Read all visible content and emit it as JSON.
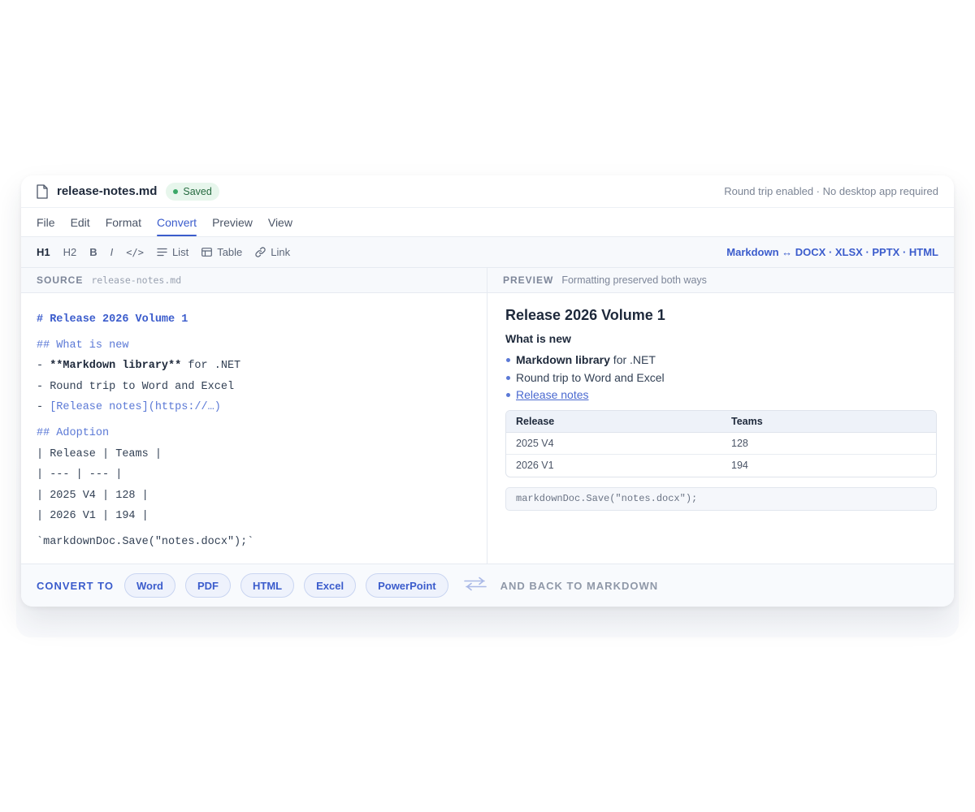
{
  "window": {
    "file_name": "release-notes.md",
    "saved_label": "Saved",
    "note": "Round trip enabled · No desktop app required",
    "colors": {
      "accent": "#3b5ccc",
      "saved_bg": "#e7f6ec",
      "saved_dot": "#3aa867"
    }
  },
  "menu": {
    "items": [
      {
        "label": "File"
      },
      {
        "label": "Edit"
      },
      {
        "label": "Format"
      },
      {
        "label": "Convert",
        "active": true
      },
      {
        "label": "Preview"
      },
      {
        "label": "View"
      }
    ]
  },
  "toolbar": {
    "h1": "H1",
    "h2": "H2",
    "bold": "B",
    "italic": "I",
    "code": "</>",
    "list": "List",
    "table": "Table",
    "link": "Link",
    "formats": "Markdown ↔ DOCX · XLSX · PPTX · HTML",
    "icons": {
      "list": "list-icon",
      "table": "table-icon",
      "link": "link-icon"
    }
  },
  "source": {
    "label": "SOURCE",
    "file": "release-notes.md",
    "lines": {
      "h1": "# Release 2026 Volume 1",
      "h2_new": "## What is new",
      "bullet1_prefix": "- ",
      "bullet1_bold": "**Markdown library**",
      "bullet1_rest": " for .NET",
      "bullet2": "- Round trip to Word and Excel",
      "bullet3_prefix": "- ",
      "bullet3_link": "[Release notes](https://…)",
      "h2_adoption": "## Adoption",
      "table_header": "| Release | Teams |",
      "table_sep": "| --- | --- |",
      "table_row1": "| 2025 V4 | 128 |",
      "table_row2": "| 2026 V1 | 194 |",
      "code": "`markdownDoc.Save(\"notes.docx\");`"
    }
  },
  "preview": {
    "label": "PREVIEW",
    "subtitle": "Formatting preserved both ways",
    "h1": "Release 2026 Volume 1",
    "h2": "What is new",
    "list": {
      "item1_bold": "Markdown library",
      "item1_rest": " for .NET",
      "item2": "Round trip to Word and Excel",
      "item3_link": "Release notes"
    },
    "table": {
      "headers": [
        "Release",
        "Teams"
      ],
      "rows": [
        [
          "2025 V4",
          "128"
        ],
        [
          "2026 V1",
          "194"
        ]
      ]
    },
    "code": "markdownDoc.Save(\"notes.docx\");"
  },
  "convert": {
    "label": "CONVERT TO",
    "targets": [
      "Word",
      "PDF",
      "HTML",
      "Excel",
      "PowerPoint"
    ],
    "back_label": "AND BACK TO MARKDOWN",
    "icon": "swap-arrows-icon"
  }
}
